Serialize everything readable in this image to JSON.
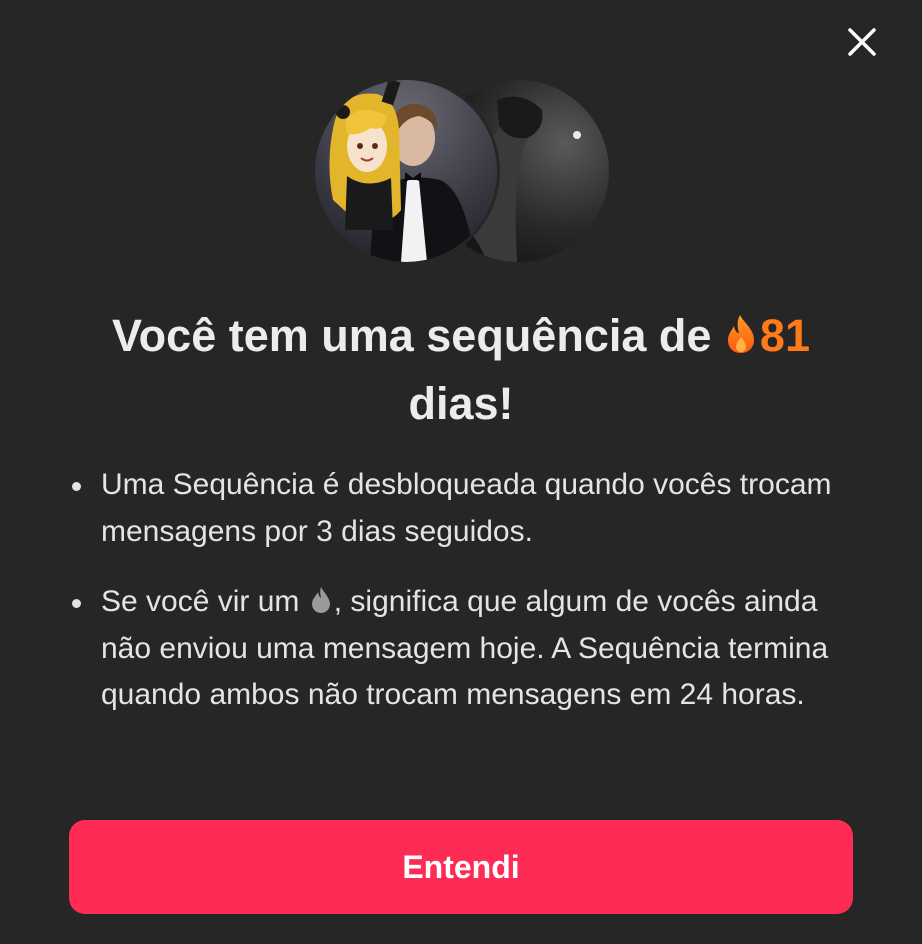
{
  "dialog": {
    "close_icon": "close-icon",
    "title_before": "Você tem uma sequência de",
    "streak_count": "81",
    "title_after": "dias!",
    "bullets": [
      {
        "text": "Uma Sequência é desbloqueada quando vocês trocam mensagens por 3 dias seguidos."
      },
      {
        "text_before": "Se você vir um",
        "text_after": ", significa que algum de vocês ainda não enviou uma mensagem hoje. A Sequência termina quando ambos não trocam mensagens em 24 horas."
      }
    ],
    "button_label": "Entendi"
  },
  "colors": {
    "background": "#262627",
    "title": "#ececec",
    "streak": "#ff7a1a",
    "button": "#fe2c55",
    "button_text": "#ffffff",
    "inactive_drop": "#9a9a9a"
  },
  "icons": {
    "streak": "flame-icon",
    "inactive_streak": "gray-flame-icon"
  }
}
